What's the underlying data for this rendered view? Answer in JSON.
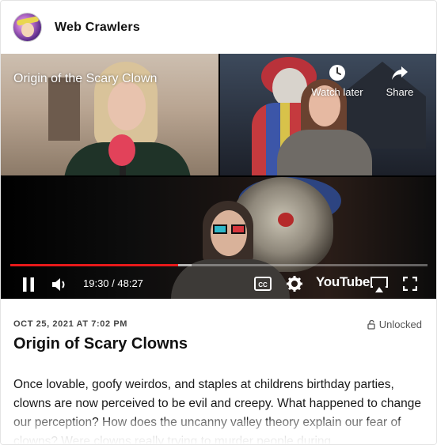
{
  "header": {
    "site_name": "Web Crawlers",
    "avatar_icon": "podcast-logo-avatar"
  },
  "video": {
    "title": "Origin of the Scary Clown",
    "watch_later_label": "Watch later",
    "share_label": "Share",
    "time_display": "19:30 / 48:27",
    "progress_fraction": 0.4024,
    "buffer_fraction": 0.4,
    "progress_color": "#e7191a",
    "youtube_label": "YouTube",
    "icons": [
      "clock-icon",
      "share-arrow-icon",
      "pause-icon",
      "volume-icon",
      "captions-icon",
      "settings-gear-icon",
      "airplay-icon",
      "fullscreen-icon"
    ]
  },
  "article": {
    "date": "OCT 25, 2021 AT 7:02 PM",
    "lock_label": "Unlocked",
    "title": "Origin of Scary Clowns",
    "body": "Once lovable, goofy weirdos, and staples at childrens birthday parties, clowns are now perceived to be evil and creepy. What happened to change our perception? How does the uncanny valley theory explain our fear of clowns? Were clowns really trying to murder people during"
  }
}
